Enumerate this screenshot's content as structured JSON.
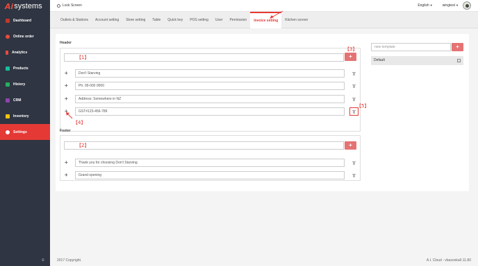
{
  "app": {
    "logo_ai": "Ai",
    "logo_text": "systems"
  },
  "sidebar": {
    "items": [
      {
        "label": "Dashboard",
        "icon": "dashboard-icon",
        "color": "#c0392b"
      },
      {
        "label": "Online order",
        "icon": "online-order-icon",
        "color": "#e74c3c"
      },
      {
        "label": "Analytics",
        "icon": "analytics-icon",
        "color": "#e74c3c"
      },
      {
        "label": "Products",
        "icon": "products-icon",
        "color": "#1abc9c"
      },
      {
        "label": "History",
        "icon": "history-icon",
        "color": "#27ae60"
      },
      {
        "label": "CRM",
        "icon": "crm-icon",
        "color": "#8e44ad"
      },
      {
        "label": "Inventory",
        "icon": "inventory-icon",
        "color": "#f1c40f"
      },
      {
        "label": "Settings",
        "icon": "settings-icon",
        "color": "#ffffff"
      }
    ],
    "menu_glyph": "≡"
  },
  "topbar": {
    "lock_label": "Lock Screen",
    "language": "English",
    "user": "wingtest"
  },
  "tabs": [
    {
      "label": "Outlets & Stations"
    },
    {
      "label": "Account setting"
    },
    {
      "label": "Store setting"
    },
    {
      "label": "Table"
    },
    {
      "label": "Quick key"
    },
    {
      "label": "POS setting"
    },
    {
      "label": "User"
    },
    {
      "label": "Permission"
    },
    {
      "label": "Invoice setting"
    },
    {
      "label": "Kitchen screen"
    }
  ],
  "header": {
    "title": "Header",
    "new_line_value": "",
    "add_label": "+",
    "lines": [
      "Don't Starving",
      "Ph: 09-000 0000",
      "Address:  Somewhere in NZ",
      "GST#123-456-789"
    ]
  },
  "footer_section": {
    "title": "Footer",
    "new_line_value": "",
    "add_label": "+",
    "lines": [
      "Thank you for choosing Don't Starving",
      "Grand opening"
    ]
  },
  "templates": {
    "input_placeholder": "new template",
    "add_label": "+",
    "items": [
      {
        "label": "Default"
      }
    ]
  },
  "annotations": {
    "a1": "【1】",
    "a2": "【2】",
    "a3": "【3】",
    "a4": "【4】",
    "a5": "【5】"
  },
  "page_footer": {
    "copyright": "2017 Copyright.",
    "version": "A.I. Cloud - vbazooka0.11.80"
  },
  "colors": {
    "accent": "#e53935",
    "sidebar_bg": "#2f3542",
    "button": "#e57373"
  }
}
